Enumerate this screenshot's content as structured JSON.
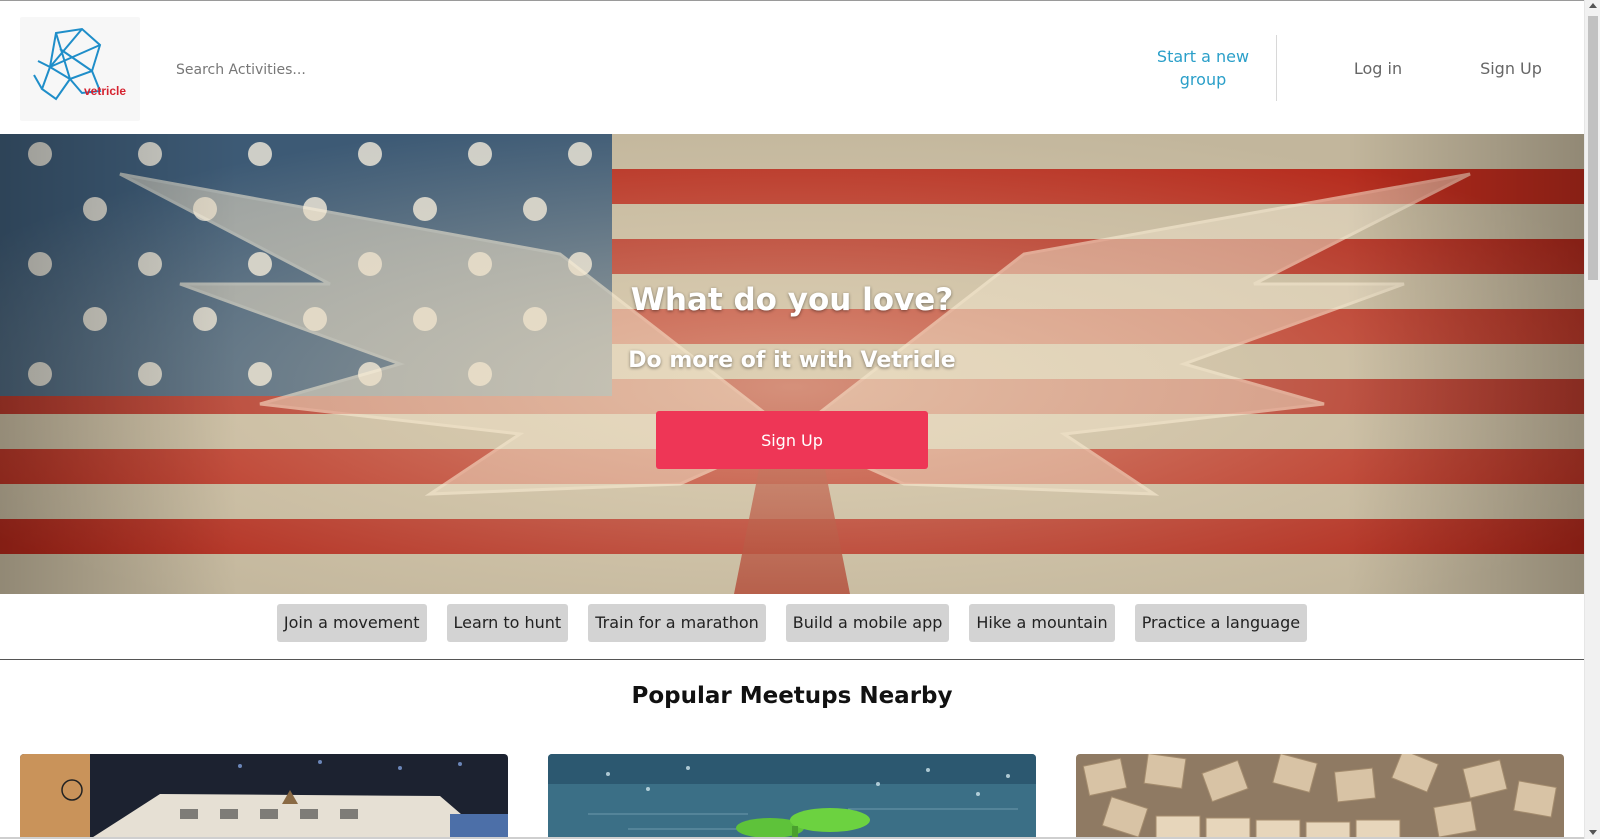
{
  "header": {
    "logo_text": "vetricle",
    "search_placeholder": "Search Activities...",
    "nav": {
      "start_group": "Start a new group",
      "login": "Log in",
      "signup": "Sign Up"
    }
  },
  "hero": {
    "title": "What do you love?",
    "subtitle": "Do more of it with Vetricle",
    "button": "Sign Up"
  },
  "chips": [
    "Join a movement",
    "Learn to hunt",
    "Train for a marathon",
    "Build a mobile app",
    "Hike a mountain",
    "Practice a language"
  ],
  "section": {
    "title": "Popular Meetups Nearby"
  },
  "colors": {
    "accent_link": "#2a9fc9",
    "cta": "#ee3656",
    "chip_bg": "#d3d3d3"
  }
}
